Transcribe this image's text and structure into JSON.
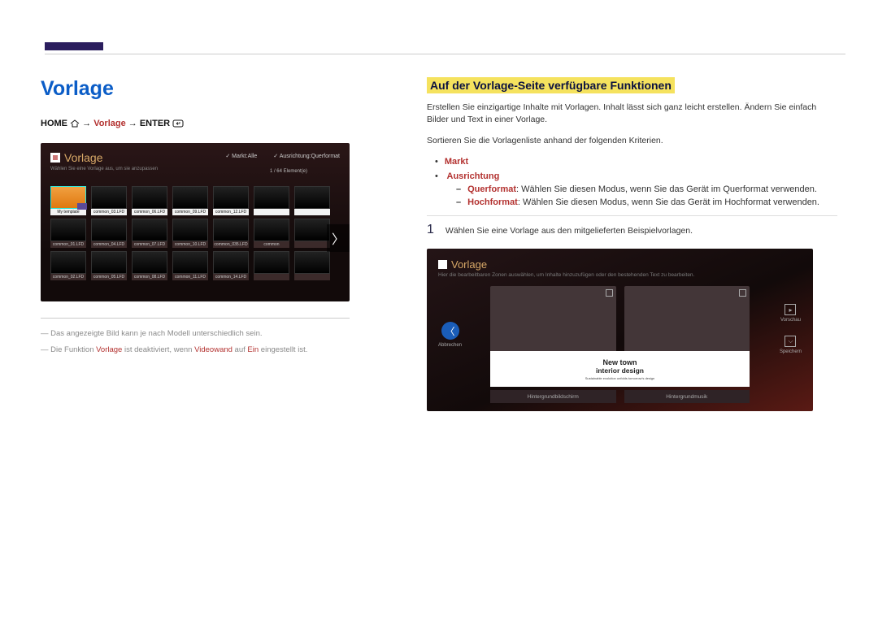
{
  "left": {
    "title": "Vorlage",
    "path_home": "HOME",
    "path_template": "Vorlage",
    "path_enter": "ENTER",
    "arrow": "→",
    "sc1": {
      "title": "Vorlage",
      "subtitle": "Wählen Sie eine Vorlage aus, um sie anzupassen",
      "tab_market": "Markt:Alle",
      "tab_orient": "Ausrichtung:Querformat",
      "counter": "1 / 64 Element(e)",
      "thumbs": [
        {
          "label": "My template",
          "sel": true
        },
        {
          "label": "common_03.LFD"
        },
        {
          "label": "common_06.LFD"
        },
        {
          "label": "common_09.LFD"
        },
        {
          "label": "common_12.LFD"
        },
        {
          "label": ""
        },
        {
          "label": ""
        },
        {
          "label": "common_01.LFD",
          "dark": true
        },
        {
          "label": "common_04.LFD",
          "dark": true
        },
        {
          "label": "common_07.LFD",
          "dark": true
        },
        {
          "label": "common_10.LFD",
          "dark": true
        },
        {
          "label": "common_035.LFD",
          "dark": true
        },
        {
          "label": "common",
          "dark": true
        },
        {
          "label": "",
          "dark": true
        },
        {
          "label": "common_02.LFD",
          "dark": true
        },
        {
          "label": "common_05.LFD",
          "dark": true
        },
        {
          "label": "common_08.LFD",
          "dark": true
        },
        {
          "label": "common_11.LFD",
          "dark": true
        },
        {
          "label": "common_14.LFD",
          "dark": true
        },
        {
          "label": "",
          "dark": true
        },
        {
          "label": "",
          "dark": true
        }
      ]
    },
    "note1_a": "Das angezeigte Bild kann je nach Modell unterschiedlich sein.",
    "note2_a": "Die Funktion ",
    "note2_b": "Vorlage",
    "note2_c": " ist deaktiviert, wenn ",
    "note2_d": "Videowand",
    "note2_e": " auf ",
    "note2_f": "Ein",
    "note2_g": " eingestellt ist."
  },
  "right": {
    "heading": "Auf der Vorlage-Seite verfügbare Funktionen",
    "para1": "Erstellen Sie einzigartige Inhalte mit Vorlagen. Inhalt lässt sich ganz leicht erstellen. Ändern Sie einfach Bilder und Text in einer Vorlage.",
    "para2": "Sortieren Sie die Vorlagenliste anhand der folgenden Kriterien.",
    "opt1": "Markt",
    "opt2": "Ausrichtung",
    "sub1_em": "Querformat",
    "sub1_txt": ": Wählen Sie diesen Modus, wenn Sie das Gerät im Querformat verwenden.",
    "sub2_em": "Hochformat",
    "sub2_txt": ": Wählen Sie diesen Modus, wenn Sie das Gerät im Hochformat verwenden.",
    "step_num": "1",
    "step_txt": "Wählen Sie eine Vorlage aus den mitgelieferten Beispielvorlagen.",
    "sc2": {
      "title": "Vorlage",
      "subtitle": "Hier die bearbeitbaren Zonen auswählen, um Inhalte hinzuzufügen oder den bestehenden Text zu bearbeiten.",
      "cap1": "New town",
      "cap2": "interior design",
      "cap3": "Sustainable evolution unfolds tomorrow's design",
      "btn_back": "Abbrechen",
      "btn_bg": "Hintergrundbildschirm",
      "btn_music": "Hintergrundmusik",
      "side_preview": "Vorschau",
      "side_save": "Speichern"
    }
  }
}
